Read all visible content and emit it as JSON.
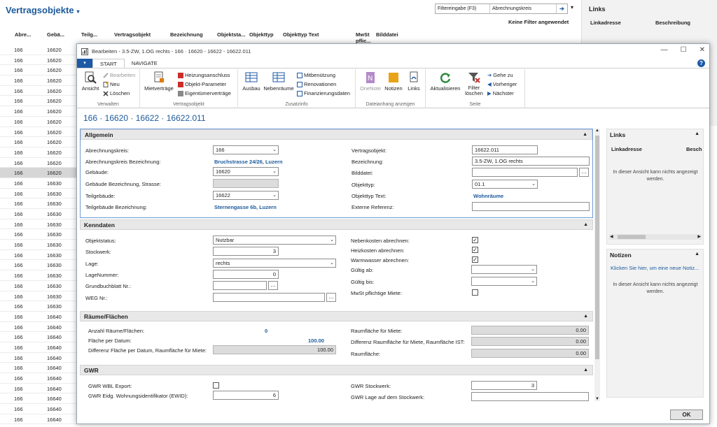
{
  "background": {
    "title": "Vertragsobjekte",
    "filter_field": "Filtereingabe (F3)",
    "filter_value": "Abrechnungskreis",
    "no_filter": "Keine Filter angewendet",
    "columns": [
      "Abre...",
      "Gebä...",
      "Teilg...",
      "Vertragsobjekt",
      "Bezeichnung",
      "Objektsta...",
      "Objekttyp",
      "Objekttyp Text",
      "MwSt pflic...",
      "Bilddatei"
    ],
    "rows": [
      {
        "a": "166",
        "b": "16620"
      },
      {
        "a": "166",
        "b": "16620"
      },
      {
        "a": "166",
        "b": "16620"
      },
      {
        "a": "166",
        "b": "16620"
      },
      {
        "a": "166",
        "b": "16620"
      },
      {
        "a": "166",
        "b": "16620"
      },
      {
        "a": "166",
        "b": "16620"
      },
      {
        "a": "166",
        "b": "16620"
      },
      {
        "a": "166",
        "b": "16620"
      },
      {
        "a": "166",
        "b": "16620"
      },
      {
        "a": "166",
        "b": "16620"
      },
      {
        "a": "166",
        "b": "16620"
      },
      {
        "a": "166",
        "b": "16620"
      },
      {
        "a": "166",
        "b": "16630"
      },
      {
        "a": "166",
        "b": "16630"
      },
      {
        "a": "166",
        "b": "16630"
      },
      {
        "a": "166",
        "b": "16630"
      },
      {
        "a": "166",
        "b": "16630"
      },
      {
        "a": "166",
        "b": "16630"
      },
      {
        "a": "166",
        "b": "16630"
      },
      {
        "a": "166",
        "b": "16630"
      },
      {
        "a": "166",
        "b": "16630"
      },
      {
        "a": "166",
        "b": "16630"
      },
      {
        "a": "166",
        "b": "16630"
      },
      {
        "a": "166",
        "b": "16630"
      },
      {
        "a": "166",
        "b": "16630"
      },
      {
        "a": "166",
        "b": "16640"
      },
      {
        "a": "166",
        "b": "16640"
      },
      {
        "a": "166",
        "b": "16640"
      },
      {
        "a": "166",
        "b": "16640"
      },
      {
        "a": "166",
        "b": "16640"
      },
      {
        "a": "166",
        "b": "16640"
      },
      {
        "a": "166",
        "b": "16640"
      },
      {
        "a": "166",
        "b": "16640"
      },
      {
        "a": "166",
        "b": "16640"
      },
      {
        "a": "166",
        "b": "16640"
      },
      {
        "a": "166",
        "b": "16640"
      }
    ],
    "selected_row": 12,
    "links_title": "Links",
    "links_col1": "Linkadresse",
    "links_col2": "Beschreibung"
  },
  "dialog": {
    "title": "Bearbeiten - 3.5-ZW, 1.OG rechts - 166 · 16620 - 16622 - 16622.011",
    "tabs": [
      "START",
      "NAVIGATE"
    ],
    "menu_glyph": "▾",
    "help": "?",
    "ribbon": {
      "verwalten": {
        "label": "Verwalten",
        "ansicht": "Ansicht",
        "bearbeiten": "Bearbeiten",
        "neu": "Neu",
        "loeschen": "Löschen"
      },
      "vertragsobjekt": {
        "label": "Vertragsobjekt",
        "mietvertraege": "Mietverträge",
        "heizung": "Heizungsanschluss",
        "objekt_param": "Objekt-Parameter",
        "eigentuemer": "Eigentümerverträge"
      },
      "zusatzinfo": {
        "label": "Zusatzinfo",
        "ausbau": "Ausbau",
        "nebenraeume": "Nebenräume",
        "mitbenuetzung": "Mitbenützung",
        "renovationen": "Renovationen",
        "finanzierung": "Finanzierungsdaten"
      },
      "dateianhang": {
        "label": "Dateianhang anzeigen",
        "onenote": "OneNote",
        "notizen": "Notizen",
        "links": "Links"
      },
      "seite": {
        "label": "Seite",
        "aktualisieren": "Aktualisieren",
        "filter_loeschen_1": "Filter",
        "filter_loeschen_2": "löschen",
        "gehe_zu": "Gehe zu",
        "vorheriger": "Vorheriger",
        "naechster": "Nächster"
      }
    },
    "record_header": "166 · 16620 · 16622 · 16622.011",
    "allgemein": {
      "title": "Allgemein",
      "abrechnungskreis_label": "Abrechnungskreis:",
      "abrechnungskreis": "166",
      "abrk_bez_label": "Abrechnungskreis Bezeichnung:",
      "abrk_bez": "Bruchstrasse 24/26, Luzern",
      "gebaeude_label": "Gebäude:",
      "gebaeude": "16620",
      "geb_bez_label": "Gebäude Bezeichnung, Strasse:",
      "geb_bez": "",
      "teilgebaeude_label": "Teilgebäude:",
      "teilgebaeude": "16622",
      "teilgeb_bez_label": "Teilgebäude Bezeichnung:",
      "teilgeb_bez": "Sternengasse 6b, Luzern",
      "vertragsobjekt_label": "Vertragsobjekt:",
      "vertragsobjekt": "16622.011",
      "bezeichnung_label": "Bezeichnung:",
      "bezeichnung": "3.5-ZW, 1.OG rechts",
      "bilddatei_label": "Bilddatei:",
      "bilddatei": "",
      "objekttyp_label": "Objekttyp:",
      "objekttyp": "01.1",
      "objekttyp_text_label": "Objekttyp Text:",
      "objekttyp_text": "Wohnräume",
      "ext_ref_label": "Externe Referenz:",
      "ext_ref": ""
    },
    "kenndaten": {
      "title": "Kenndaten",
      "objektstatus_label": "Objektstatus:",
      "objektstatus": "Nutzbar",
      "stockwerk_label": "Stockwerk:",
      "stockwerk": "3",
      "lage_label": "Lage:",
      "lage": "rechts",
      "lagenummer_label": "LageNummer:",
      "lagenummer": "0",
      "grundbuch_label": "Grundbuchblatt Nr.:",
      "grundbuch": "",
      "weg_label": "WEG Nr.:",
      "weg": "",
      "nebenkosten_label": "Nebenkosten abrechnen:",
      "nebenkosten": true,
      "heizkosten_label": "Heizkosten abrechnen:",
      "heizkosten": true,
      "warmwasser_label": "Warmwasser abrechnen:",
      "warmwasser": true,
      "gueltig_ab_label": "Gültig ab:",
      "gueltig_ab": "",
      "gueltig_bis_label": "Gültig bis:",
      "gueltig_bis": "",
      "mwst_label": "MwSt pflichtige Miete:",
      "mwst": false
    },
    "raeume": {
      "title": "Räume/Flächen",
      "anzahl_label": "Anzahl Räume/Flächen:",
      "anzahl": "0",
      "flaeche_datum_label": "Fläche per Datum:",
      "flaeche_datum": "100.00",
      "diff_datum_label": "Differenz Fläche per Datum, Raumfläche für Miete:",
      "diff_datum": "100.00",
      "rf_miete_label": "Raumfläche für Miete:",
      "rf_miete": "0.00",
      "diff_ist_label": "Differenz Raumfläche für Miete, Raumfläche IST:",
      "diff_ist": "0.00",
      "raumflaeche_label": "Raumfläche:",
      "raumflaeche": "0.00"
    },
    "gwr": {
      "title": "GWR",
      "wbl_label": "GWR WBL Export:",
      "wbl": false,
      "ewid_label": "GWR Eidg. Wohnungsidentifikator (EWID):",
      "ewid": "6",
      "stockwerk_label": "GWR Stockwerk:",
      "stockwerk": "3",
      "lage_label": "GWR Lage auf dem Stockwerk:",
      "lage": ""
    },
    "factbox": {
      "links_title": "Links",
      "links_col1": "Linkadresse",
      "links_col2": "Besch",
      "links_msg": "In dieser Ansicht kann nichts angezeigt werden.",
      "notizen_title": "Notizen",
      "notizen_link": "Klicken Sie hier, um eine neue Notiz...",
      "notizen_msg": "In dieser Ansicht kann nichts angezeigt werden."
    },
    "ok": "OK"
  }
}
